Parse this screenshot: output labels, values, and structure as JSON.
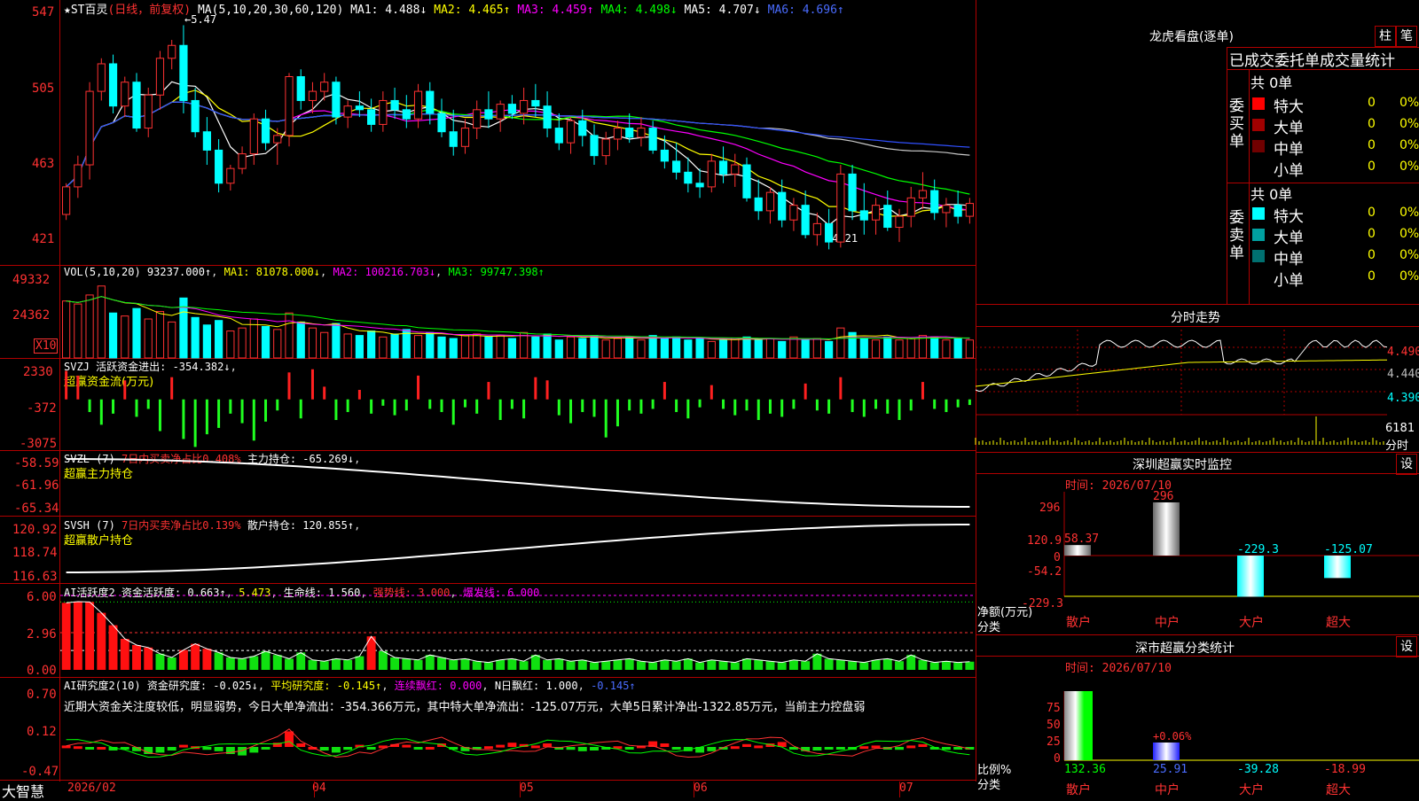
{
  "main_header": {
    "star": "★",
    "name": "ST百灵",
    "period": "(日线，前复权)",
    "ma_label": "MA(5,10,20,30,60,120)",
    "ma_items": [
      {
        "label": "MA1:",
        "value": "4.488↓",
        "color": "#ffffff"
      },
      {
        "label": "MA2:",
        "value": "4.465↑",
        "color": "#ffff00"
      },
      {
        "label": "MA3:",
        "value": "4.459↑",
        "color": "#ff00ff"
      },
      {
        "label": "MA4:",
        "value": "4.498↓",
        "color": "#00ff00"
      },
      {
        "label": "MA5:",
        "value": "4.707↓",
        "color": "#ffffff"
      },
      {
        "label": "MA6:",
        "value": "4.696↑",
        "color": "#4a6cff"
      }
    ],
    "price_axis": [
      "547",
      "505",
      "463",
      "421"
    ],
    "high_marker": "←5.47",
    "low_marker": "←4.21"
  },
  "vol_panel": {
    "title": "VOL(5,10,20) 93237.000↑",
    "ma1": "MA1: 81078.000↓",
    "ma2": "MA2: 100216.703↓",
    "ma3": "MA3: 99747.398↑",
    "axis": [
      "49332",
      "24362"
    ],
    "unit": "X10"
  },
  "svzj_panel": {
    "title": "SVZJ  活跃资金进出: -354.382↓",
    "subtitle": "超赢资金流(万元)",
    "axis": [
      "2330",
      "-372",
      "-3075"
    ]
  },
  "svzl_panel": {
    "title_a": "SVZL (7)",
    "title_b": "7日内买卖净占比0.408%",
    "title_c": "主力持仓: -65.269↓",
    "subtitle": "超赢主力持仓",
    "axis": [
      "-58.59",
      "-61.96",
      "-65.34"
    ]
  },
  "svsh_panel": {
    "title_a": "SVSH (7)",
    "title_b": "7日内买卖净占比0.139%",
    "title_c": "散户持仓: 120.855↑",
    "subtitle": "超赢散户持仓",
    "axis": [
      "120.92",
      "118.74",
      "116.63"
    ]
  },
  "ai_active_panel": {
    "title_a": "AI活跃度2",
    "title_b": "资金活跃度: 0.663↑",
    "title_c": "5.473",
    "title_d": "生命线: 1.560",
    "title_e": "强势线: 3.000",
    "title_f": "爆发线: 6.000",
    "axis": [
      "6.00",
      "2.96",
      "0.00"
    ]
  },
  "ai_research_panel": {
    "title_a": "AI研究度2(10)",
    "title_b": "资金研究度: -0.025↓",
    "title_c": "平均研究度: -0.145↑",
    "title_d": "连续飘红: 0.000",
    "title_e": "N日飘红: 1.000",
    "title_f": "-0.145↑",
    "note": "近期大资金关注度较低，明显弱势，今日大单净流出：-354.366万元，其中特大单净流出：-125.07万元，大单5日累计净出-1322.85万元，当前主力控盘弱",
    "axis": [
      "0.70",
      "0.12",
      "-0.47"
    ]
  },
  "bottom_bar": {
    "brand": "大智慧",
    "dates": [
      "2026/02",
      "04",
      "05",
      "06",
      "07"
    ]
  },
  "right_panel": {
    "title": "龙虎看盘(逐单)",
    "btn1": "柱",
    "btn2": "笔",
    "tabs": "已成交委托单成交量统计",
    "buy": {
      "side_label": "委买单",
      "total": "共 0单",
      "rows": [
        {
          "label": "特大",
          "value": "0",
          "pct": "0%",
          "color": "#ff0000"
        },
        {
          "label": "大单",
          "value": "0",
          "pct": "0%",
          "color": "#a00000"
        },
        {
          "label": "中单",
          "value": "0",
          "pct": "0%",
          "color": "#700000"
        },
        {
          "label": "小单",
          "value": "0",
          "pct": "0%",
          "color": ""
        }
      ]
    },
    "sell": {
      "side_label": "委卖单",
      "total": "共 0单",
      "rows": [
        {
          "label": "特大",
          "value": "0",
          "pct": "0%",
          "color": "#00ffff"
        },
        {
          "label": "大单",
          "value": "0",
          "pct": "0%",
          "color": "#00a0a0"
        },
        {
          "label": "中单",
          "value": "0",
          "pct": "0%",
          "color": "#007070"
        },
        {
          "label": "小单",
          "value": "0",
          "pct": "0%",
          "color": ""
        }
      ]
    },
    "intraday": {
      "title": "分时走势",
      "axis": [
        "4.490",
        "4.440",
        "4.390"
      ],
      "vol_label": "6181",
      "vol_unit": "分时"
    },
    "monitor": {
      "title": "深圳超赢实时监控",
      "set": "设",
      "time": "时间: 2026/07/10",
      "axis": [
        "296",
        "120.9",
        "0",
        "-54.2",
        "-229.3"
      ],
      "ylabel1": "净额(万元)",
      "ylabel2": "分类",
      "categories": [
        "散户",
        "中户",
        "大户",
        "超大"
      ],
      "values": [
        58.37,
        296,
        -229.3,
        -125.07
      ],
      "value_labels": [
        "58.37",
        "296",
        "-229.3",
        "-125.07"
      ]
    },
    "classify": {
      "title": "深市超赢分类统计",
      "set": "设",
      "time": "时间: 2026/07/10",
      "axis": [
        "75",
        "50",
        "25",
        "0"
      ],
      "ylabel1": "比例%",
      "ylabel2": "分类",
      "categories": [
        "散户",
        "中户",
        "大户",
        "超大"
      ],
      "values": [
        "132.36",
        "25.91",
        "-39.28",
        "-18.99"
      ],
      "mid_label": "+0.06%"
    }
  },
  "chart_data": {
    "type": "candlestick",
    "candles": [
      [
        443,
        460,
        440,
        458
      ],
      [
        458,
        475,
        452,
        470
      ],
      [
        470,
        515,
        462,
        510
      ],
      [
        510,
        528,
        505,
        525
      ],
      [
        525,
        530,
        498,
        502
      ],
      [
        502,
        518,
        496,
        515
      ],
      [
        515,
        520,
        488,
        490
      ],
      [
        490,
        512,
        485,
        508
      ],
      [
        508,
        532,
        500,
        528
      ],
      [
        528,
        538,
        522,
        535
      ],
      [
        535,
        546,
        498,
        505
      ],
      [
        505,
        512,
        485,
        488
      ],
      [
        488,
        496,
        470,
        478
      ],
      [
        478,
        484,
        455,
        460
      ],
      [
        460,
        470,
        456,
        468
      ],
      [
        468,
        480,
        465,
        476
      ],
      [
        476,
        498,
        470,
        495
      ],
      [
        495,
        500,
        478,
        482
      ],
      [
        482,
        490,
        470,
        486
      ],
      [
        486,
        520,
        480,
        518
      ],
      [
        518,
        522,
        500,
        505
      ],
      [
        505,
        515,
        498,
        510
      ],
      [
        510,
        520,
        505,
        515
      ],
      [
        515,
        518,
        492,
        496
      ],
      [
        496,
        505,
        490,
        502
      ],
      [
        502,
        510,
        496,
        500
      ],
      [
        500,
        506,
        488,
        492
      ],
      [
        492,
        510,
        488,
        505
      ],
      [
        505,
        512,
        495,
        500
      ],
      [
        500,
        508,
        490,
        495
      ],
      [
        495,
        514,
        490,
        510
      ],
      [
        510,
        515,
        492,
        498
      ],
      [
        498,
        506,
        485,
        488
      ],
      [
        488,
        500,
        475,
        480
      ],
      [
        480,
        495,
        476,
        490
      ],
      [
        490,
        505,
        484,
        500
      ],
      [
        500,
        510,
        490,
        495
      ],
      [
        495,
        505,
        488,
        503
      ],
      [
        503,
        508,
        495,
        498
      ],
      [
        498,
        512,
        492,
        505
      ],
      [
        505,
        514,
        496,
        502
      ],
      [
        502,
        510,
        485,
        490
      ],
      [
        490,
        498,
        478,
        482
      ],
      [
        482,
        496,
        476,
        494
      ],
      [
        494,
        500,
        480,
        486
      ],
      [
        486,
        492,
        470,
        475
      ],
      [
        475,
        488,
        470,
        484
      ],
      [
        484,
        494,
        478,
        490
      ],
      [
        490,
        498,
        482,
        485
      ],
      [
        485,
        496,
        480,
        490
      ],
      [
        490,
        494,
        476,
        478
      ],
      [
        478,
        486,
        468,
        472
      ],
      [
        472,
        482,
        462,
        466
      ],
      [
        466,
        474,
        455,
        460
      ],
      [
        460,
        468,
        452,
        458
      ],
      [
        458,
        476,
        455,
        472
      ],
      [
        472,
        480,
        460,
        465
      ],
      [
        465,
        476,
        458,
        470
      ],
      [
        470,
        474,
        450,
        452
      ],
      [
        452,
        462,
        440,
        445
      ],
      [
        445,
        458,
        438,
        455
      ],
      [
        455,
        462,
        436,
        440
      ],
      [
        440,
        452,
        434,
        448
      ],
      [
        448,
        456,
        430,
        432
      ],
      [
        432,
        444,
        426,
        438
      ],
      [
        438,
        446,
        424,
        428
      ],
      [
        428,
        470,
        425,
        465
      ],
      [
        465,
        470,
        440,
        445
      ],
      [
        445,
        460,
        432,
        440
      ],
      [
        440,
        452,
        432,
        448
      ],
      [
        448,
        456,
        434,
        436
      ],
      [
        436,
        446,
        428,
        442
      ],
      [
        442,
        458,
        436,
        452
      ],
      [
        452,
        466,
        446,
        456
      ],
      [
        456,
        462,
        440,
        444
      ],
      [
        444,
        452,
        436,
        448
      ],
      [
        448,
        456,
        438,
        442
      ],
      [
        442,
        452,
        438,
        449
      ]
    ],
    "ma": [
      {
        "name": "MA1",
        "color": "#ffffff"
      },
      {
        "name": "MA2",
        "color": "#ffff00"
      },
      {
        "name": "MA3",
        "color": "#ff00ff"
      },
      {
        "name": "MA4",
        "color": "#00ff00"
      },
      {
        "name": "MA5",
        "color": "#c8c8c8"
      },
      {
        "name": "MA6",
        "color": "#3050ff"
      }
    ],
    "ylim": [
      416,
      552
    ],
    "volume": [
      38000,
      36000,
      42000,
      48000,
      30000,
      28000,
      33000,
      26000,
      31000,
      24000,
      40000,
      27000,
      22000,
      25000,
      18000,
      20000,
      26000,
      21000,
      19000,
      30000,
      24000,
      20000,
      17000,
      23000,
      16000,
      15000,
      18000,
      14000,
      16000,
      19000,
      15000,
      17000,
      14000,
      13000,
      15000,
      16000,
      14000,
      15000,
      13000,
      17000,
      14000,
      16000,
      12000,
      14000,
      13000,
      15000,
      12000,
      13000,
      14000,
      12000,
      15000,
      13000,
      14000,
      12000,
      13000,
      11000,
      12000,
      13000,
      14000,
      12000,
      13000,
      11000,
      14000,
      12000,
      13000,
      11000,
      20000,
      17000,
      13000,
      12000,
      14000,
      12000,
      13000,
      15000,
      14000,
      12000,
      13000,
      12000
    ],
    "vol_max": 52000,
    "svzj": [
      1800,
      1500,
      -800,
      -1600,
      -900,
      1200,
      -1100,
      -600,
      -2000,
      1400,
      -2500,
      -3000,
      -2200,
      -1800,
      -900,
      -1500,
      -2600,
      -1400,
      -700,
      1700,
      -1200,
      1900,
      800,
      -1300,
      -800,
      600,
      -900,
      -400,
      -1000,
      -700,
      1500,
      -600,
      -800,
      -1600,
      -500,
      -900,
      1100,
      -1300,
      -600,
      -1200,
      1400,
      1200,
      -1000,
      -1500,
      -800,
      -1100,
      -2400,
      -1700,
      -700,
      -900,
      -600,
      1100,
      -800,
      -1200,
      -500,
      900,
      -600,
      -1000,
      -700,
      -1300,
      -900,
      -1100,
      -600,
      1000,
      -700,
      -900,
      1400,
      -800,
      -1100,
      -600,
      -900,
      -1300,
      -700,
      1100,
      -600,
      -800,
      -500,
      -354
    ],
    "svzj_lim": [
      -3200,
      2500
    ],
    "ai_active": [
      5.4,
      5.5,
      5.47,
      4.6,
      3.6,
      2.5,
      2.0,
      1.8,
      1.3,
      1.0,
      1.6,
      2.1,
      1.7,
      1.4,
      1.0,
      0.9,
      1.1,
      1.5,
      1.2,
      0.9,
      1.4,
      0.8,
      0.7,
      0.9,
      0.8,
      1.1,
      2.7,
      1.5,
      1.0,
      0.9,
      0.8,
      1.2,
      1.0,
      0.8,
      0.9,
      0.7,
      0.6,
      0.8,
      0.9,
      0.7,
      1.2,
      0.8,
      0.9,
      0.7,
      0.8,
      0.6,
      0.7,
      0.8,
      0.9,
      0.7,
      0.6,
      0.8,
      0.7,
      0.9,
      0.6,
      0.8,
      0.7,
      0.6,
      0.9,
      0.8,
      0.7,
      0.6,
      0.8,
      0.7,
      1.3,
      0.9,
      0.8,
      0.7,
      0.6,
      0.8,
      0.9,
      0.7,
      1.2,
      0.8,
      0.6,
      0.7,
      0.6,
      0.66
    ],
    "ai_research": [
      0.02,
      0.01,
      -0.03,
      0.0,
      -0.05,
      -0.02,
      -0.06,
      -0.1,
      -0.08,
      -0.05,
      0.03,
      0.01,
      -0.04,
      -0.06,
      -0.1,
      -0.12,
      -0.08,
      -0.02,
      0.06,
      0.22,
      0.05,
      0.0,
      -0.05,
      -0.08,
      -0.04,
      0.03,
      -0.02,
      0.02,
      0.04,
      0.03,
      -0.03,
      0.0,
      0.05,
      -0.02,
      -0.06,
      -0.04,
      0.01,
      0.03,
      0.06,
      0.04,
      0.02,
      0.05,
      -0.02,
      -0.04,
      -0.06,
      -0.05,
      -0.03,
      0.01,
      -0.02,
      0.02,
      0.08,
      0.05,
      -0.03,
      -0.06,
      -0.08,
      -0.06,
      -0.02,
      0.01,
      0.04,
      0.02,
      0.05,
      0.07,
      -0.03,
      -0.06,
      -0.05,
      -0.03,
      -0.02,
      -0.04,
      0.01,
      0.02,
      -0.03,
      -0.04,
      0.02,
      0.04,
      -0.02,
      -0.04,
      -0.03,
      -0.025
    ]
  }
}
